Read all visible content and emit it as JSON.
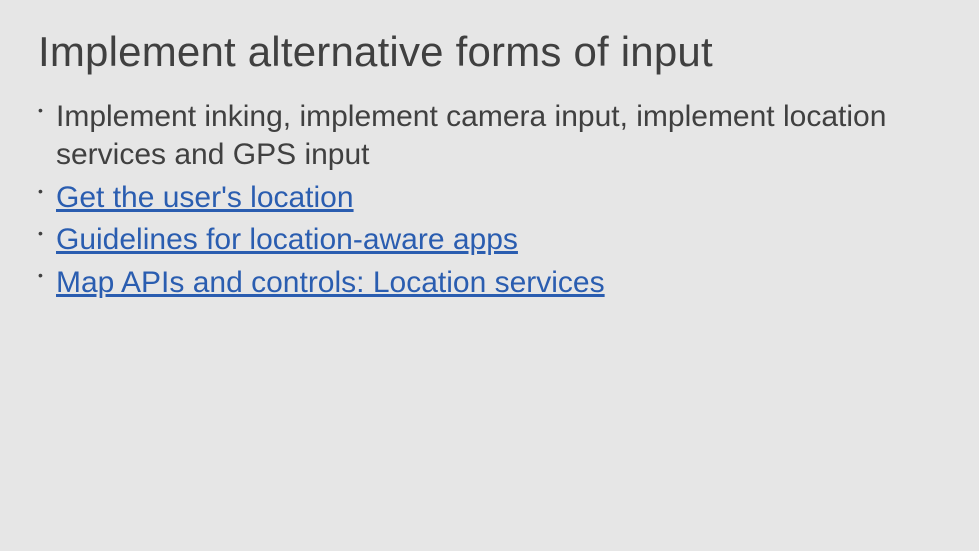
{
  "title": "Implement alternative forms of input",
  "bullets": {
    "b1_text": "Implement inking, implement camera input, implement location services and GPS input",
    "b2_link": "Get the user's location",
    "b3_link": "Guidelines for location-aware apps",
    "b4_link": "Map APIs and controls: Location services"
  }
}
